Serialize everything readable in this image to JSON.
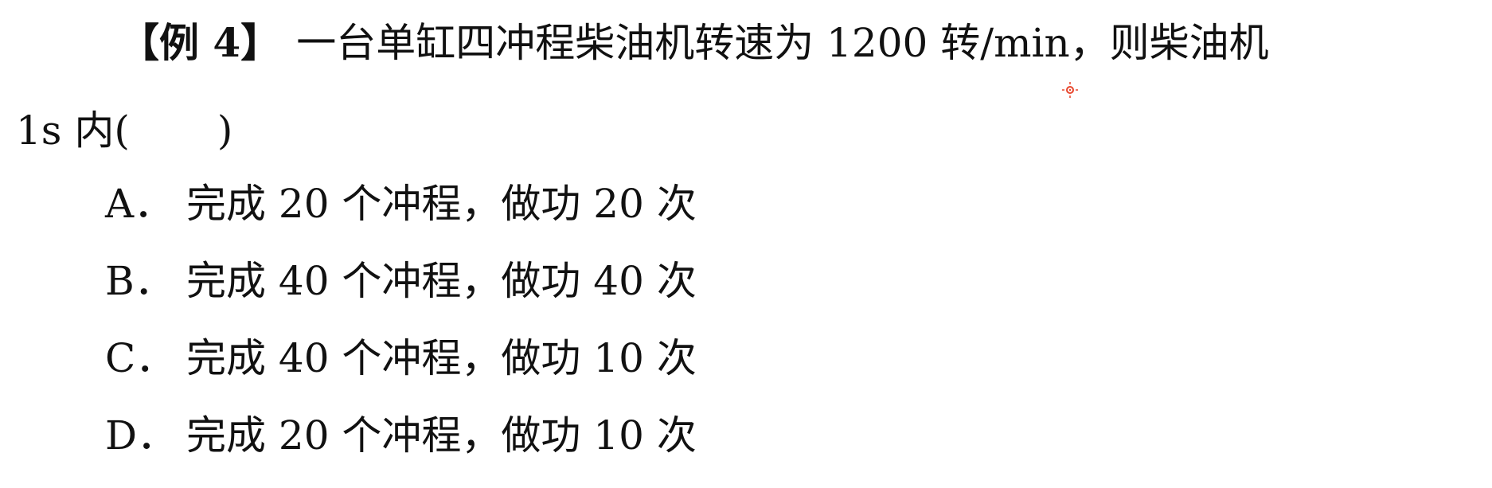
{
  "question": {
    "label": "【例 4】",
    "stem_line1": "一台单缸四冲程柴油机转速为 1200 转/min，则柴油机",
    "stem_line2_start": "1s 内(",
    "stem_line2_end": ")"
  },
  "options": [
    {
      "letter": "A．",
      "text": "完成 20 个冲程，做功 20 次"
    },
    {
      "letter": "B．",
      "text": "完成 40 个冲程，做功 40 次"
    },
    {
      "letter": "C．",
      "text": "完成 40 个冲程，做功 10 次"
    },
    {
      "letter": "D．",
      "text": "完成 20 个冲程，做功 10 次"
    }
  ],
  "cursor": {
    "icon": "crosshair-cursor-icon",
    "color": "#e8452c"
  }
}
